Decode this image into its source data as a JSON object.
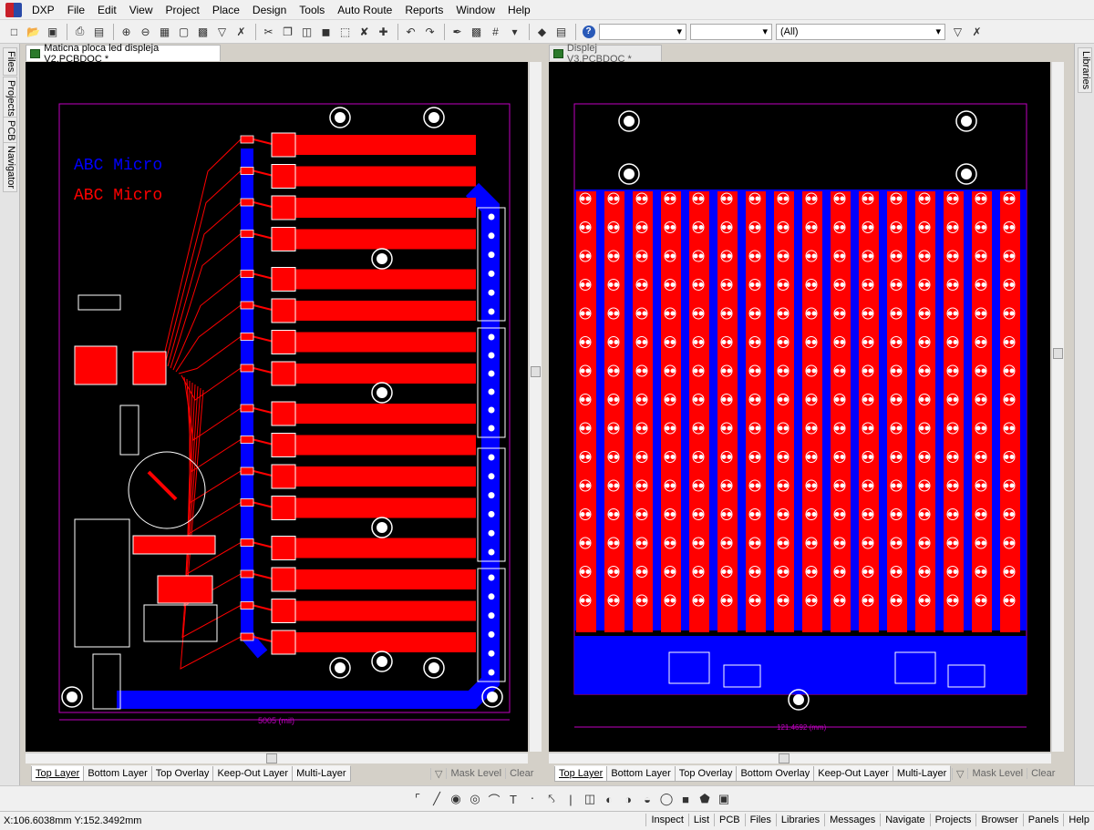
{
  "menu": {
    "app": "DXP",
    "items": [
      "File",
      "Edit",
      "View",
      "Project",
      "Place",
      "Design",
      "Tools",
      "Auto Route",
      "Reports",
      "Window",
      "Help"
    ]
  },
  "toolbar": {
    "filter_value": "(All)"
  },
  "side_panels": {
    "left": [
      "Files",
      "Projects",
      "PCB",
      "Navigator"
    ],
    "right": [
      "Libraries"
    ]
  },
  "documents": [
    {
      "title": "Maticna ploca led displeja V2.PCBDOC *",
      "active": true,
      "silk_text_blue": "ABC Micro",
      "silk_text_red": "ABC Micro",
      "dimension_label": "5005 (mil)"
    },
    {
      "title": "Displej V3.PCBDOC *",
      "active": false,
      "dimension_label": "121.4692 (mm)"
    }
  ],
  "layer_tabs": [
    "Top Layer",
    "Bottom Layer",
    "Top Overlay",
    "Keep-Out Layer",
    "Multi-Layer"
  ],
  "layer_tabs_right": [
    "Top Layer",
    "Bottom Layer",
    "Top Overlay",
    "Bottom Overlay",
    "Keep-Out Layer",
    "Multi-Layer"
  ],
  "mask": {
    "mask_level": "Mask Level",
    "clear": "Clear"
  },
  "status": {
    "coordinates": "X:106.6038mm Y:152.3492mm",
    "panels": [
      "Inspect",
      "List",
      "PCB",
      "Files",
      "Libraries",
      "Messages",
      "Navigate",
      "Projects",
      "Browser",
      "Panels",
      "Help"
    ]
  },
  "colors": {
    "board_bg": "#000000",
    "top_copper": "#ff0000",
    "bottom_copper": "#0000ff",
    "overlay": "#ffffff",
    "keepout": "#c000c0"
  }
}
